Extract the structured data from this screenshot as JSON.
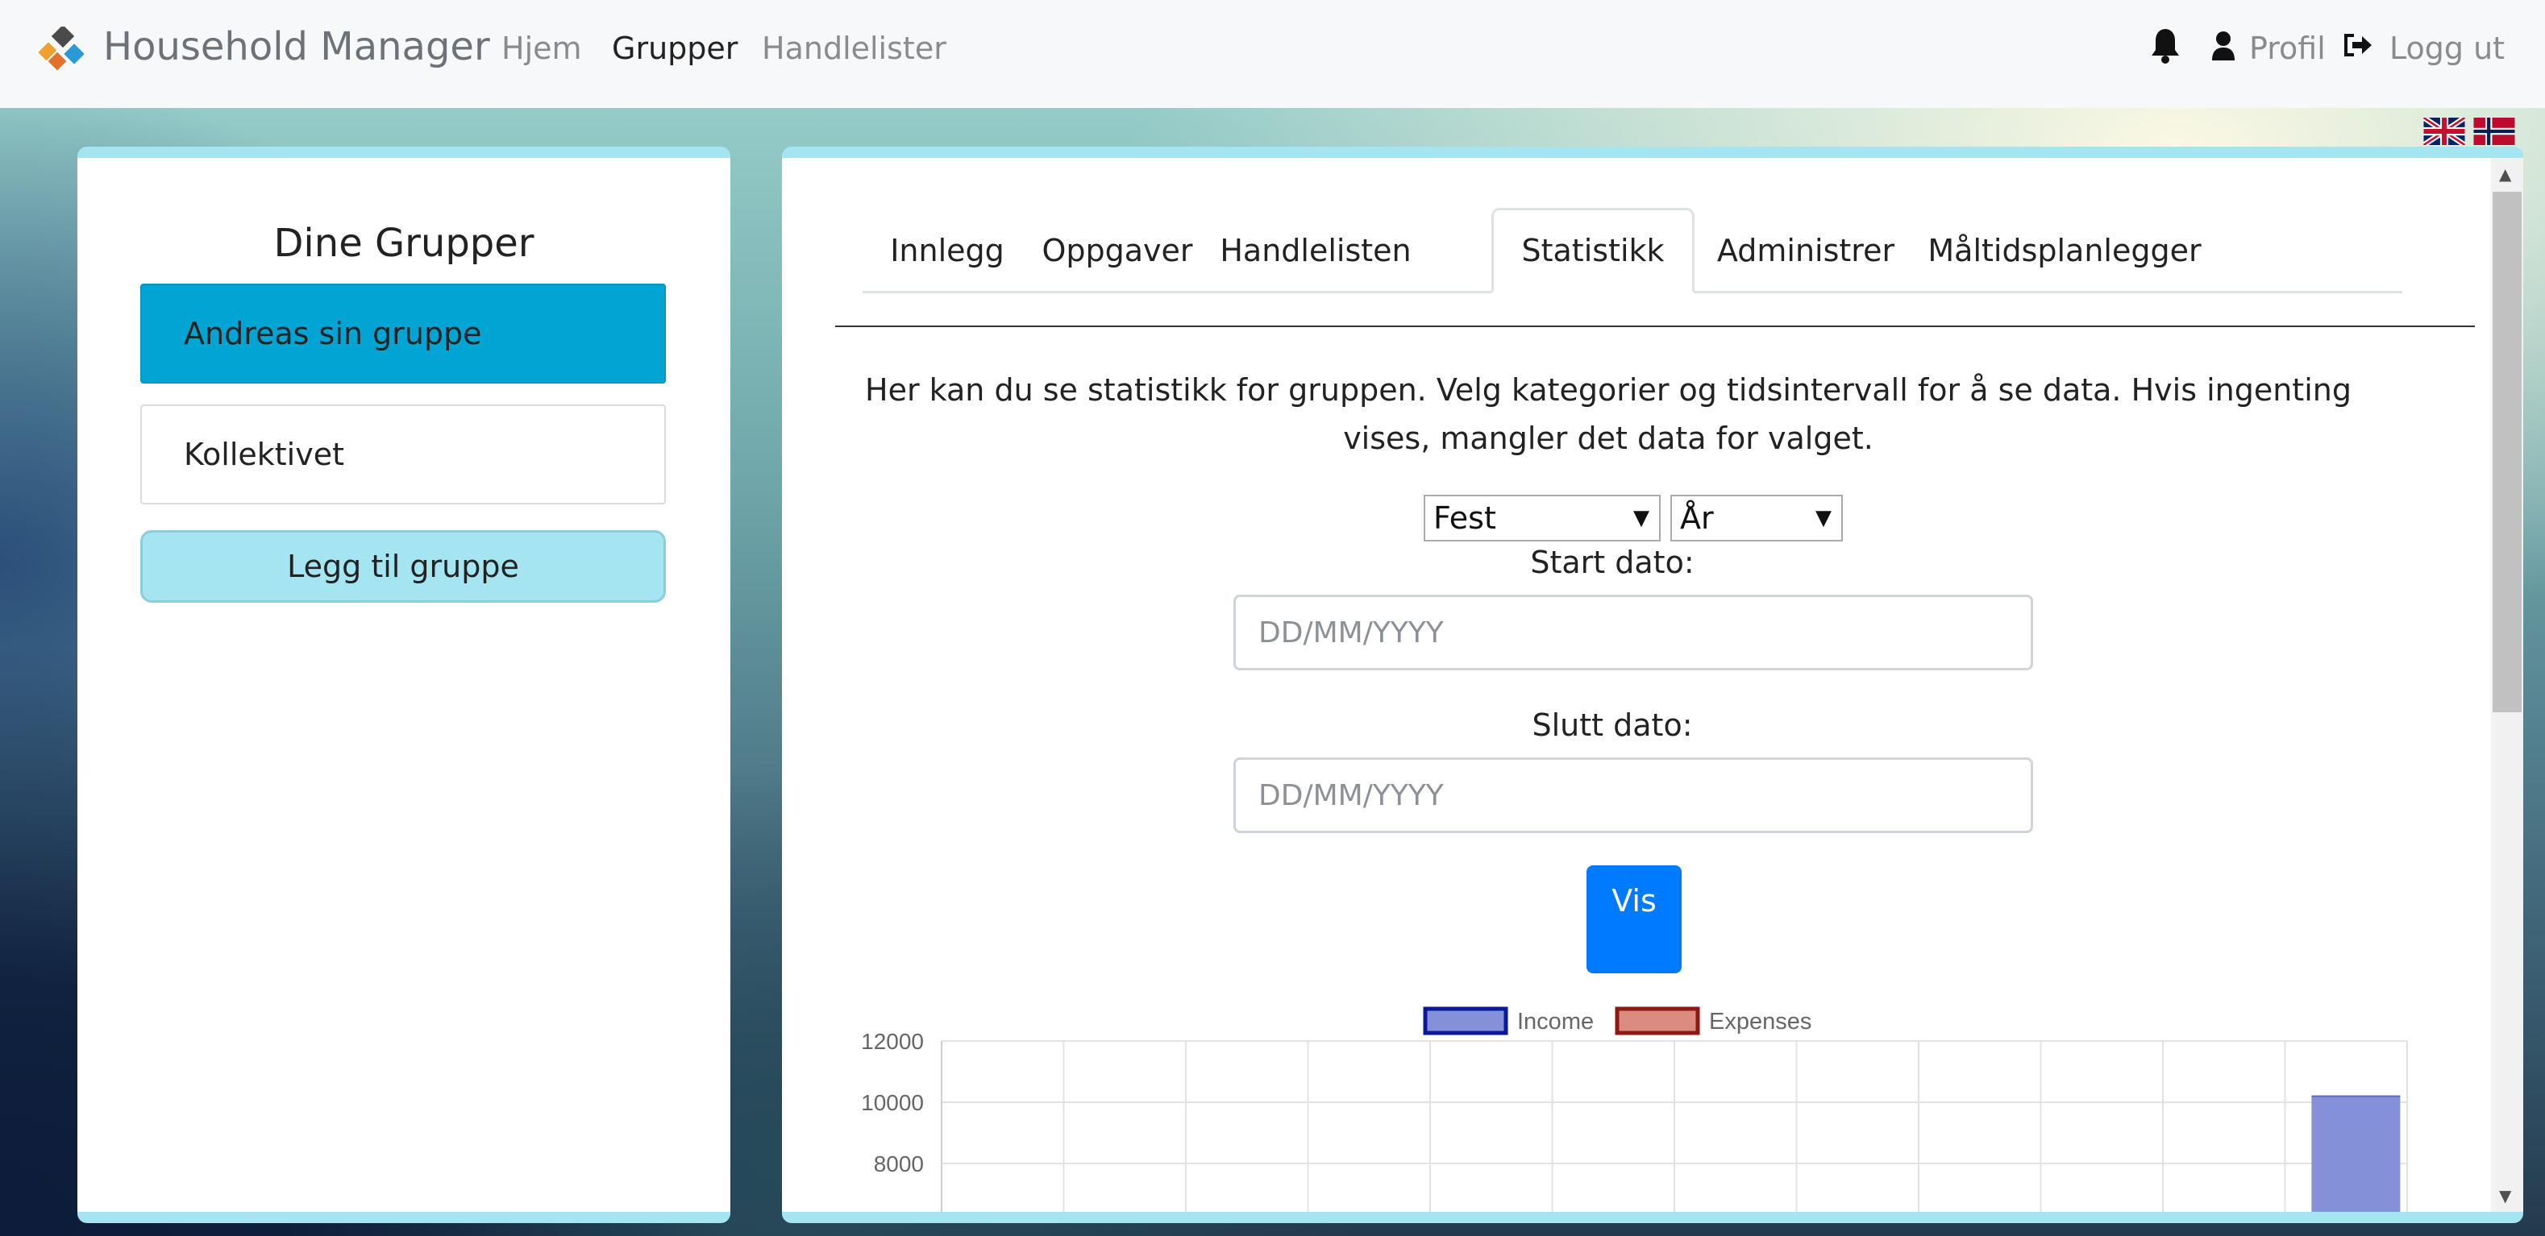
{
  "navbar": {
    "brand": "Household Manager",
    "links": [
      "Hjem",
      "Grupper",
      "Handlelister"
    ],
    "active_link": "Grupper",
    "profile": "Profil",
    "logout": "Logg ut"
  },
  "sidebar": {
    "title": "Dine Grupper",
    "groups": [
      {
        "name": "Andreas sin gruppe",
        "active": true
      },
      {
        "name": "Kollektivet",
        "active": false
      }
    ],
    "add_button": "Legg til gruppe"
  },
  "tabs": [
    "Innlegg",
    "Oppgaver",
    "Handlelisten",
    "Statistikk",
    "Administrer",
    "Måltidsplanlegger"
  ],
  "active_tab": "Statistikk",
  "stats": {
    "description": "Her kan du se statistikk for gruppen. Velg kategorier og tidsintervall for å se data. Hvis ingenting vises, mangler det data for valget.",
    "category_select": "Fest",
    "interval_select": "År",
    "start_label": "Start dato:",
    "start_placeholder": "DD/MM/YYYY",
    "end_label": "Slutt dato:",
    "end_placeholder": "DD/MM/YYYY",
    "submit_label": "Vis"
  },
  "chart_data": {
    "type": "bar",
    "series": [
      {
        "name": "Income",
        "color": "#8490d8",
        "border": "#0a1a96",
        "values": [
          0,
          0,
          0,
          0,
          0,
          0,
          0,
          0,
          0,
          0,
          0,
          10200
        ]
      },
      {
        "name": "Expenses",
        "color": "#db8c80",
        "border": "#8a1a12",
        "values": [
          0,
          0,
          0,
          0,
          0,
          0,
          0,
          0,
          0,
          0,
          0,
          0
        ]
      }
    ],
    "y_ticks": [
      12000,
      10000,
      8000
    ],
    "ylim": [
      0,
      12000
    ],
    "grid": true,
    "legend": "top"
  }
}
